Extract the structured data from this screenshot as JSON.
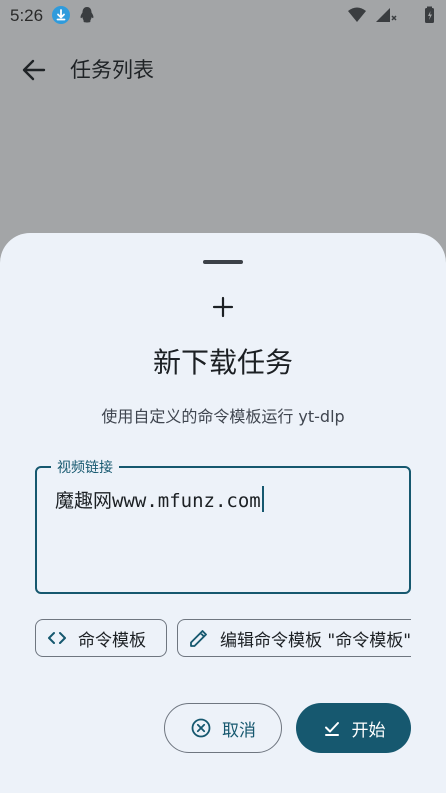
{
  "status_bar": {
    "time": "5:26"
  },
  "appbar": {
    "title": "任务列表"
  },
  "sheet": {
    "title": "新下载任务",
    "subtitle": "使用自定义的命令模板运行 yt-dlp",
    "url_field": {
      "label": "视频链接",
      "value": "魔趣网www.mfunz.com"
    },
    "chips": {
      "template_label": "命令模板",
      "edit_template_label": "编辑命令模板 \"命令模板\""
    },
    "buttons": {
      "cancel_label": "取消",
      "start_label": "开始"
    }
  },
  "colors": {
    "primary": "#16586f",
    "sheet_bg": "#edf2f9",
    "scrim": "#a3a5a7",
    "download_badge": "#2f9bdc"
  }
}
